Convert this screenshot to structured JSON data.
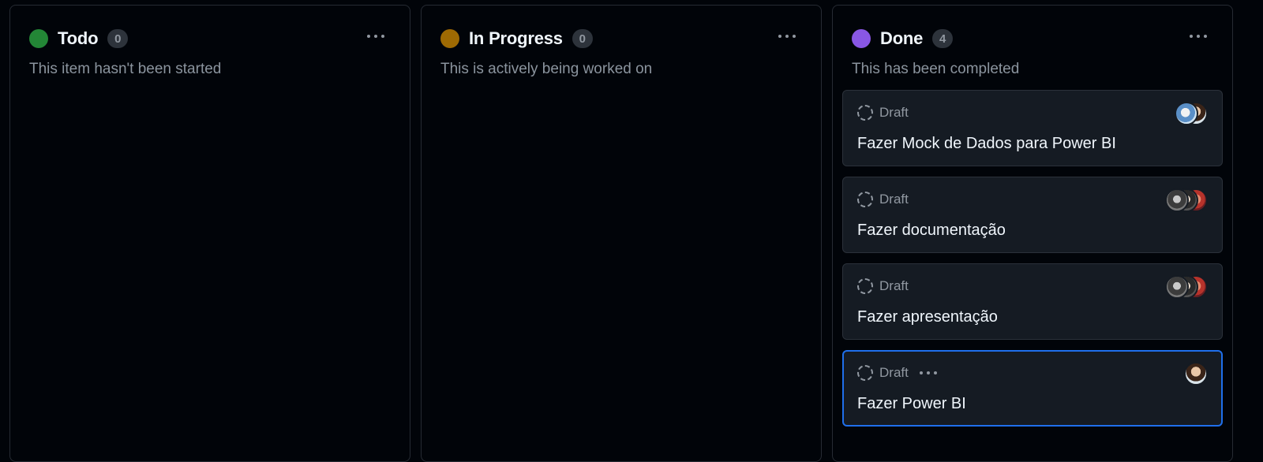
{
  "columns": [
    {
      "title": "Todo",
      "count": "0",
      "description": "This item hasn't been started",
      "status_color": "#238636",
      "cards": []
    },
    {
      "title": "In Progress",
      "count": "0",
      "description": "This is actively being worked on",
      "status_color": "#9e6a03",
      "cards": []
    },
    {
      "title": "Done",
      "count": "4",
      "description": "This has been completed",
      "status_color": "#8957e5",
      "cards": [
        {
          "type": "Draft",
          "title": "Fazer Mock de Dados para Power BI",
          "assignees": [
            "avatar",
            "avatar"
          ]
        },
        {
          "type": "Draft",
          "title": "Fazer documentação",
          "assignees": [
            "avatar",
            "avatar",
            "avatar"
          ]
        },
        {
          "type": "Draft",
          "title": "Fazer apresentação",
          "assignees": [
            "avatar",
            "avatar",
            "avatar"
          ]
        },
        {
          "type": "Draft",
          "title": "Fazer Power BI",
          "assignees": [
            "avatar"
          ],
          "selected": true
        }
      ]
    }
  ],
  "colors": {
    "background": "#010409",
    "card": "#151b23",
    "selected_border": "#1f6feb"
  },
  "icons": {
    "column_menu": "kebab-horizontal-icon",
    "draft": "draft-issue-icon"
  }
}
